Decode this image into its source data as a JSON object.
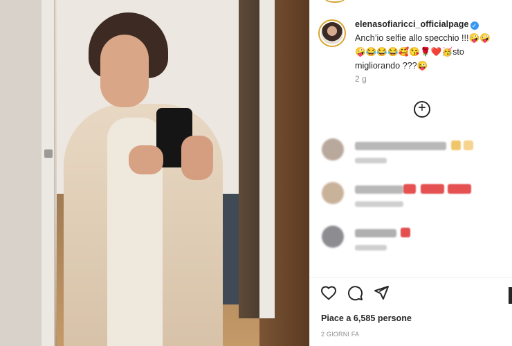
{
  "post": {
    "username": "elenasofiaricci_officialpage",
    "caption_line1": "Anch’io selfie allo specchio !!!🤪🤪",
    "caption_line2": "🤪😂😂😂🥰😘🌹❤️🥳sto",
    "caption_line3": "migliorando ???😜",
    "time_ago": "2 g",
    "likes_text": "Piace a 6,585 persone",
    "date_text": "2 GIORNI FA"
  },
  "icons": {
    "verified": "verified-badge-icon",
    "plus": "plus-circle-icon",
    "like": "heart-icon",
    "comment": "comment-icon",
    "share": "paper-plane-icon"
  },
  "colors": {
    "accent_verified": "#3897f0",
    "ring": "#d9a42d"
  },
  "labels": {
    "verified_glyph": "✓",
    "plus_glyph": "+"
  }
}
